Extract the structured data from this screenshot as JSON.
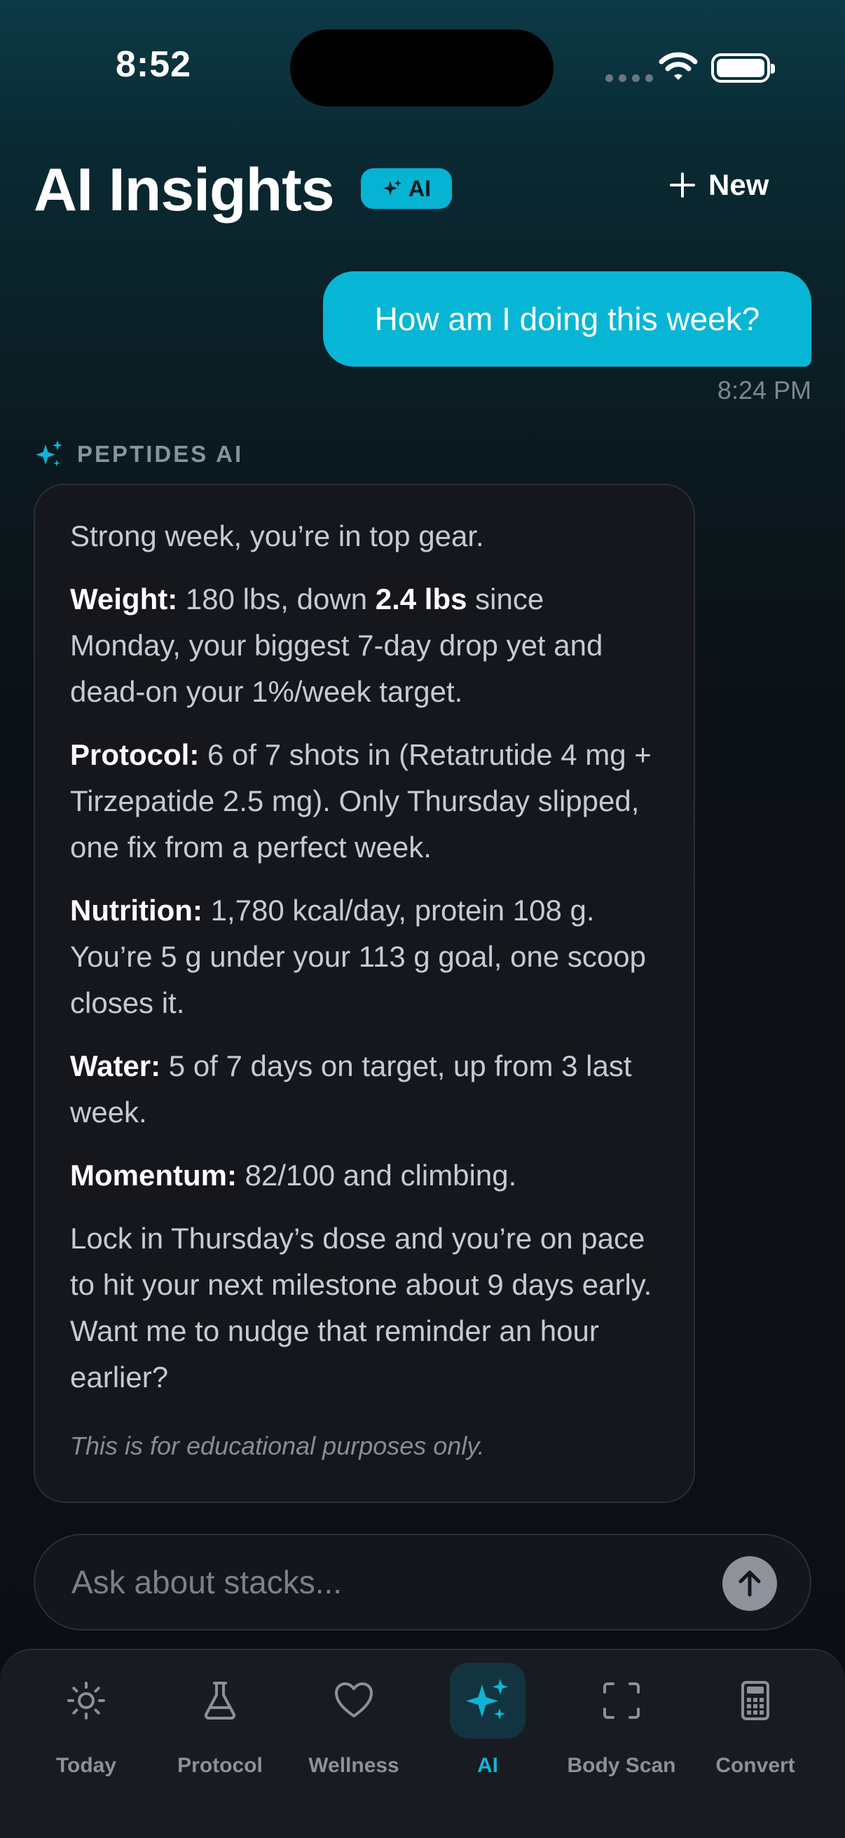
{
  "status_bar": {
    "time": "8:52"
  },
  "header": {
    "title": "AI Insights",
    "badge": "AI",
    "new_button": "New"
  },
  "user_message": {
    "text": "How am I doing this week?",
    "time": "8:24 PM"
  },
  "assistant": {
    "label": "PEPTIDES AI",
    "intro": "Strong week, you’re in top gear.",
    "sections": [
      {
        "key": "Weight:",
        "text1": " 180 lbs, down ",
        "bold": "2.4 lbs",
        "text2": " since Monday, your biggest 7-day drop yet and dead-on your 1%/week target."
      },
      {
        "key": "Protocol:",
        "text": " 6 of 7 shots in (Retatrutide 4 mg + Tirzepatide 2.5 mg). Only Thursday slipped, one fix from a perfect week."
      },
      {
        "key": "Nutrition:",
        "text": " 1,780 kcal/day, protein 108 g. You’re 5 g under your 113 g goal, one scoop closes it."
      },
      {
        "key": "Water:",
        "text": " 5 of 7 days on target, up from 3 last week."
      },
      {
        "key": "Momentum:",
        "text": " 82/100 and climbing."
      }
    ],
    "closing": "Lock in Thursday’s dose and you’re on pace to hit your next milestone about 9 days early. Want me to nudge that reminder an hour earlier?",
    "disclaimer": "This is for educational purposes only."
  },
  "input": {
    "placeholder": "Ask about stacks..."
  },
  "tabs": [
    {
      "label": "Today",
      "icon": "sun-icon"
    },
    {
      "label": "Protocol",
      "icon": "flask-icon"
    },
    {
      "label": "Wellness",
      "icon": "heart-icon"
    },
    {
      "label": "AI",
      "icon": "sparkles-icon",
      "active": true
    },
    {
      "label": "Body Scan",
      "icon": "scan-icon"
    },
    {
      "label": "Convert",
      "icon": "calculator-icon"
    }
  ],
  "colors": {
    "accent": "#07b6d5",
    "card_bg": "#15171c",
    "tab_active": "#11b4d4"
  }
}
